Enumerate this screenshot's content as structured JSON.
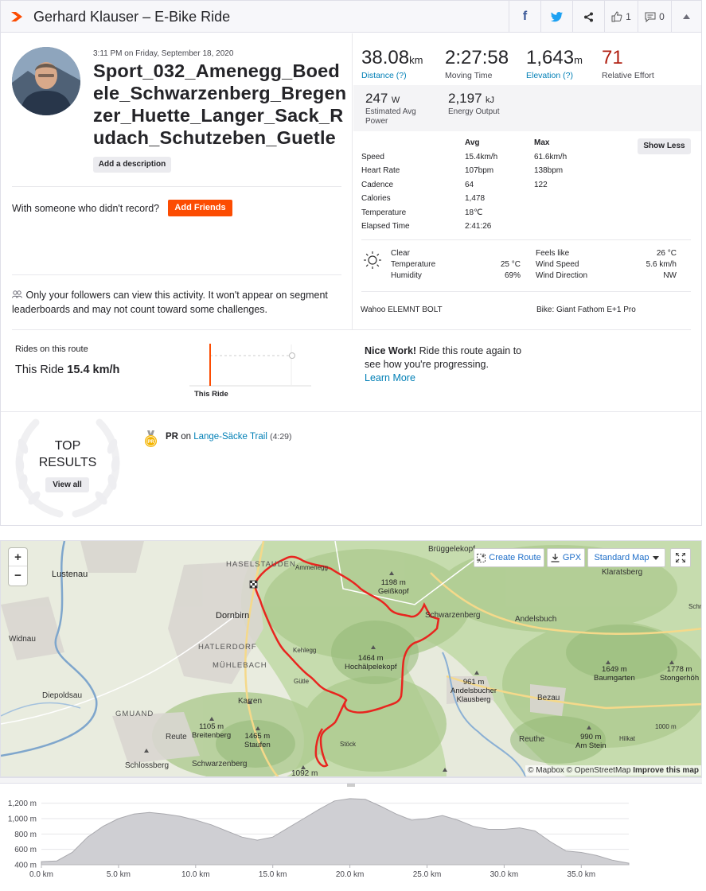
{
  "header": {
    "title": "Gerhard Klauser – E-Bike Ride",
    "kudos_count": "1",
    "comment_count": "0"
  },
  "activity": {
    "datetime": "3:11 PM on Friday, September 18, 2020",
    "name": "Sport_032_Amenegg_Boedele_Schwarzenberg_Bregenzer_Huette_Langer_Sack_Rudach_Schutzeben_Guetle",
    "add_description": "Add a description",
    "with_someone": "With someone who didn't record?",
    "add_friends": "Add Friends",
    "privacy_note": "Only your followers can view this activity. It won't appear on segment leaderboards and may not count toward some challenges."
  },
  "stats": {
    "distance": {
      "value": "38.08",
      "unit": "km",
      "label": "Distance (?)"
    },
    "moving_time": {
      "value": "2:27:58",
      "label": "Moving Time"
    },
    "elevation": {
      "value": "1,643",
      "unit": "m",
      "label": "Elevation (?)"
    },
    "relative_effort": {
      "value": "71",
      "label": "Relative Effort"
    },
    "power": {
      "value": "247",
      "unit": "W",
      "label_1": "Estimated Avg",
      "label_2": "Power"
    },
    "energy": {
      "value": "2,197",
      "unit": "kJ",
      "label": "Energy Output"
    }
  },
  "details": {
    "col_avg": "Avg",
    "col_max": "Max",
    "show_less": "Show Less",
    "rows": [
      {
        "label": "Speed",
        "avg": "15.4km/h",
        "max": "61.6km/h"
      },
      {
        "label": "Heart Rate",
        "avg": "107bpm",
        "max": "138bpm"
      },
      {
        "label": "Cadence",
        "avg": "64",
        "max": "122"
      },
      {
        "label": "Calories",
        "avg": "1,478",
        "max": ""
      },
      {
        "label": "Temperature",
        "avg": "18℃",
        "max": ""
      },
      {
        "label": "Elapsed Time",
        "avg": "2:41:26",
        "max": ""
      }
    ]
  },
  "weather": {
    "condition": "Clear",
    "temperature_label": "Temperature",
    "temperature": "25 °C",
    "humidity_label": "Humidity",
    "humidity": "69%",
    "feels_like_label": "Feels like",
    "feels_like": "26 °C",
    "wind_speed_label": "Wind Speed",
    "wind_speed": "5.6 km/h",
    "wind_direction_label": "Wind Direction",
    "wind_direction": "NW"
  },
  "gear": {
    "device": "Wahoo ELEMNT BOLT",
    "bike": "Bike: Giant Fathom E+1 Pro"
  },
  "route": {
    "title": "Rides on this route",
    "this_ride_prefix": "This Ride",
    "this_ride_speed": "15.4 km/h",
    "chart_label": "This Ride",
    "nice_work": "Nice Work!",
    "nice_text": "Ride this route again to see how you're progressing.",
    "learn_more": "Learn More"
  },
  "results": {
    "top_line1": "TOP",
    "top_line2": "RESULTS",
    "view_all": "View all",
    "pr_badge": "PR",
    "pr_label": "PR",
    "pr_on": "on",
    "pr_segment": "Lange-Säcke Trail",
    "pr_time": "(4:29)"
  },
  "map": {
    "create_route": "Create Route",
    "gpx": "GPX",
    "map_type": "Standard Map",
    "attribution_1": "© Mapbox © OpenStreetMap",
    "attribution_2": "Improve this map",
    "labels": {
      "lustenau": "Lustenau",
      "haselstauden": "HASELSTAUDEN",
      "ammenegg": "Ammenegg",
      "bruggelekopf": "Brüggelekopf",
      "dornbirn": "Dornbirn",
      "widnau": "Widnau",
      "hatlerdorf": "HATLERDORF",
      "muhlebach": "MÜHLEBACH",
      "kehlegg": "Kehlegg",
      "gutle": "Gütle",
      "diepoldsau": "Diepoldsau",
      "karren": "Karren",
      "gmuand": "GMUAND",
      "reute1": "Reute",
      "breitenberg_h": "1105 m",
      "breitenberg": "Breitenberg",
      "staufen_h": "1465 m",
      "staufen": "Staufen",
      "schlossberg": "Schlossberg",
      "schwarzenberg2": "Schwarzenberg",
      "h1092": "1092 m",
      "geisskopf_h": "1198 m",
      "geisskopf": "Geißkopf",
      "hochalpelekopf_h": "1464 m",
      "hochalpelekopf": "Hochälpelekopf",
      "schwarzenberg": "Schwarzenberg",
      "andelsbuch": "Andelsbuch",
      "klaratsberg": "Klaratsberg",
      "schr": "Schr",
      "andelsbucher_h": "961 m",
      "andelsbucher": "Andelsbucher",
      "klausberg": "Klausberg",
      "bezau": "Bezau",
      "baumgarten_h": "1649 m",
      "baumgarten": "Baumgarten",
      "stongerhohe_h": "1778 m",
      "stongerhohe": "Stongerhöh",
      "reute2": "Reuthe",
      "hilkat": "Hilkat",
      "amstein_h": "990 m",
      "amstein": "Am Stein",
      "h1000": "1000 m",
      "stock": "Stöck"
    }
  },
  "chart_data": {
    "type": "area",
    "title": "",
    "xlabel": "",
    "ylabel": "",
    "x_unit": "km",
    "y_unit": "m",
    "xlim": [
      0,
      38.08
    ],
    "ylim": [
      400,
      1300
    ],
    "y_ticks": [
      "400 m",
      "600 m",
      "800 m",
      "1,000 m",
      "1,200 m"
    ],
    "x_ticks": [
      "0.0 km",
      "5.0 km",
      "10.0 km",
      "15.0 km",
      "20.0 km",
      "25.0 km",
      "30.0 km",
      "35.0 km"
    ],
    "grid": true,
    "x": [
      0,
      1,
      2,
      3,
      4,
      5,
      6,
      7,
      8,
      9,
      10,
      11,
      12,
      13,
      14,
      15,
      16,
      17,
      18,
      19,
      20,
      21,
      22,
      23,
      24,
      25,
      26,
      27,
      28,
      29,
      30,
      31,
      32,
      33,
      34,
      35,
      36,
      37,
      38.08
    ],
    "y": [
      440,
      450,
      560,
      760,
      900,
      1000,
      1060,
      1080,
      1060,
      1030,
      980,
      920,
      840,
      760,
      720,
      760,
      880,
      1000,
      1120,
      1230,
      1260,
      1250,
      1160,
      1060,
      980,
      1000,
      1040,
      980,
      900,
      860,
      860,
      880,
      840,
      700,
      580,
      560,
      520,
      460,
      420
    ]
  }
}
